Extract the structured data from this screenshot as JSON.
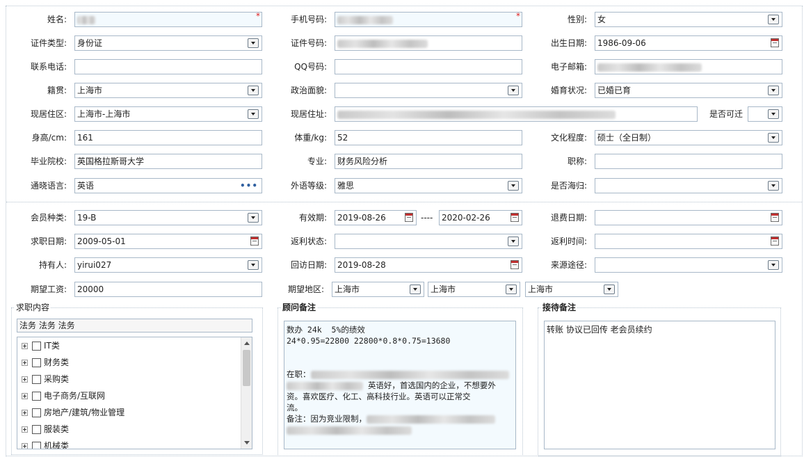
{
  "personal": {
    "name_label": "姓名:",
    "phone_label": "手机号码:",
    "gender_label": "性别:",
    "gender": "女",
    "id_type_label": "证件类型:",
    "id_type": "身份证",
    "id_no_label": "证件号码:",
    "birth_label": "出生日期:",
    "birth": "1986-09-06",
    "contact_label": "联系电话:",
    "qq_label": "QQ号码:",
    "email_label": "电子邮箱:",
    "origin_label": "籍贯:",
    "origin": "上海市",
    "politics_label": "政治面貌:",
    "marital_label": "婚育状况:",
    "marital": "已婚已育",
    "residence_label": "现居住区:",
    "residence": "上海市-上海市",
    "address_label": "现居住址:",
    "relocate_label": "是否可迁",
    "height_label": "身高/cm:",
    "height": "161",
    "weight_label": "体重/kg:",
    "weight": "52",
    "education_label": "文化程度:",
    "education": "硕士（全日制）",
    "school_label": "毕业院校:",
    "school": "英国格拉斯哥大学",
    "major_label": "专业:",
    "major": "财务风险分析",
    "title_label": "职称:",
    "language_label": "通晓语言:",
    "language": "英语",
    "lang_level_label": "外语等级:",
    "lang_level": "雅思",
    "overseas_label": "是否海归:"
  },
  "member": {
    "type_label": "会员种类:",
    "type": "19-B",
    "valid_label": "有效期:",
    "valid_from": "2019-08-26",
    "valid_sep": "----",
    "valid_to": "2020-02-26",
    "refund_label": "退费日期:",
    "job_date_label": "求职日期:",
    "job_date": "2009-05-01",
    "rebate_status_label": "返利状态:",
    "rebate_time_label": "返利时间:",
    "holder_label": "持有人:",
    "holder": "yirui027",
    "visit_label": "回访日期:",
    "visit": "2019-08-28",
    "source_label": "来源途径:",
    "salary_label": "期望工资:",
    "salary": "20000",
    "region_label": "期望地区:",
    "region1": "上海市",
    "region2": "上海市",
    "region3": "上海市"
  },
  "job_content": {
    "title": "求职内容",
    "selected": "法务 法务 法务",
    "tree": [
      "IT类",
      "财务类",
      "采购类",
      "电子商务/互联网",
      "房地产/建筑/物业管理",
      "服装类",
      "机械类"
    ]
  },
  "advisor": {
    "title": "顾问备注",
    "line1": "数办 24k  5%的绩效",
    "line2": "24*0.95=22800 22800*0.8*0.75=13680",
    "line3": "在职：",
    "line4": "英语好，首选国内的企业，不想要外",
    "line5": "资。喜欢医疗、化工、高科技行业。英语可以正常交",
    "line6": "流。",
    "line7": "备注：因为竞业限制，"
  },
  "reception": {
    "title": "接待备注",
    "text": "转账 协议已回传 老会员续约"
  }
}
